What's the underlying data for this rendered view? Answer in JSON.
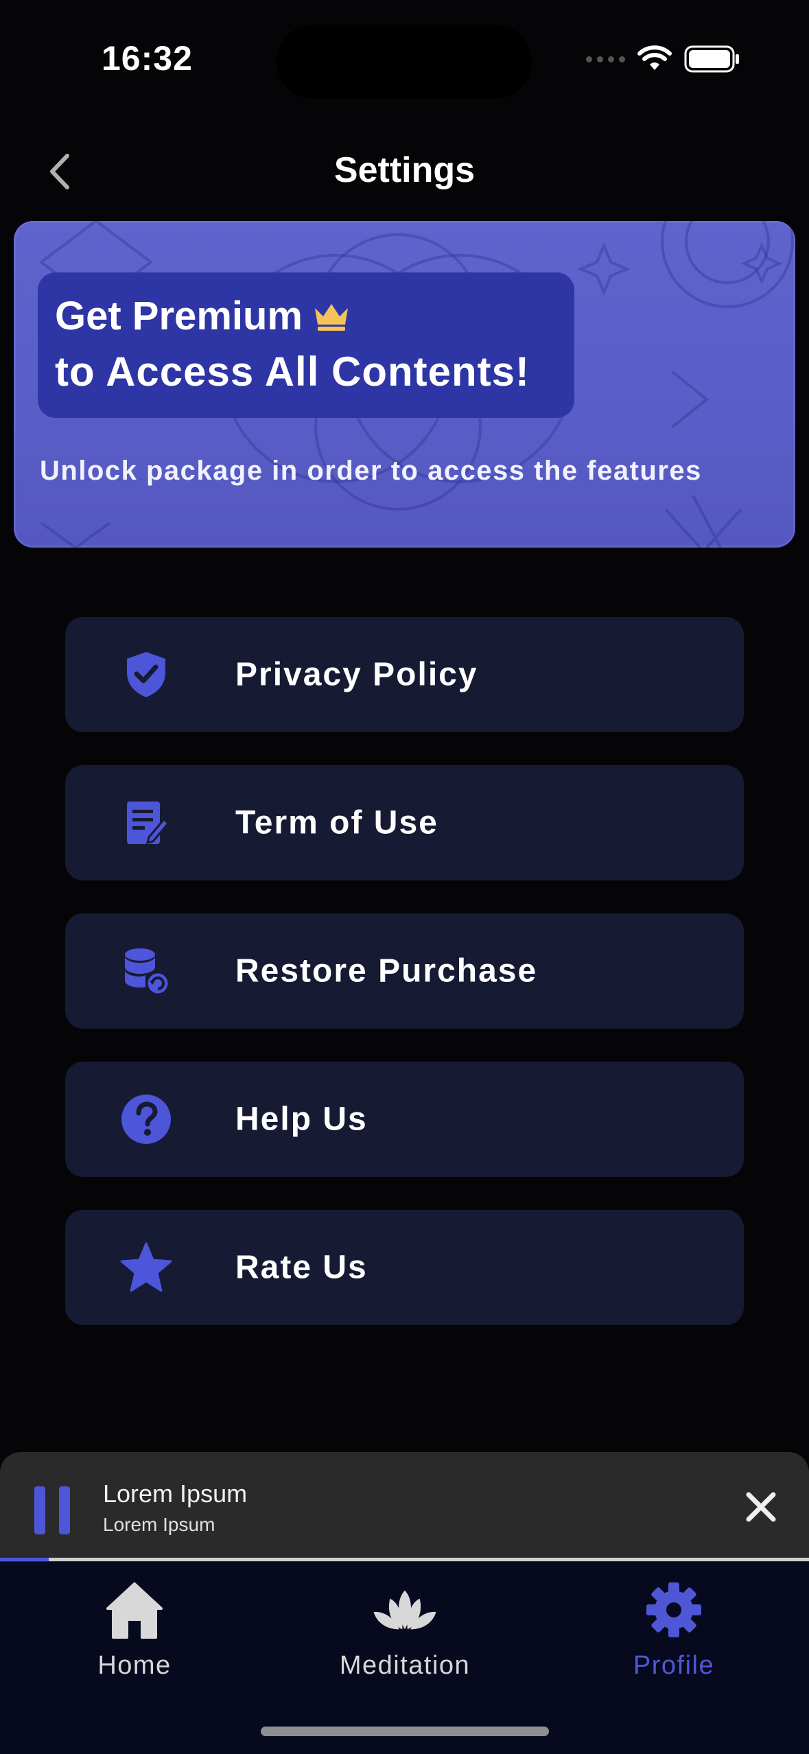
{
  "status_bar": {
    "time": "16:32"
  },
  "header": {
    "title": "Settings"
  },
  "banner": {
    "line1": "Get Premium",
    "line2": "to Access All Contents!",
    "subtitle": "Unlock package in order to access the features"
  },
  "menu": [
    {
      "label": "Privacy Policy",
      "icon": "shield-check-icon"
    },
    {
      "label": "Term of Use",
      "icon": "document-edit-icon"
    },
    {
      "label": "Restore Purchase",
      "icon": "database-restore-icon"
    },
    {
      "label": "Help Us",
      "icon": "question-circle-icon"
    },
    {
      "label": "Rate Us",
      "icon": "star-icon"
    }
  ],
  "player": {
    "title": "Lorem Ipsum",
    "subtitle": "Lorem Ipsum",
    "progress": 0.06
  },
  "tabs": [
    {
      "label": "Home",
      "icon": "home-icon",
      "active": false
    },
    {
      "label": "Meditation",
      "icon": "lotus-icon",
      "active": false
    },
    {
      "label": "Profile",
      "icon": "gear-icon",
      "active": true
    }
  ],
  "colors": {
    "accent": "#4f57d6",
    "banner": "#5a5ec8",
    "banner_box": "#2e35a5",
    "card": "#161a33",
    "background": "#050508"
  }
}
